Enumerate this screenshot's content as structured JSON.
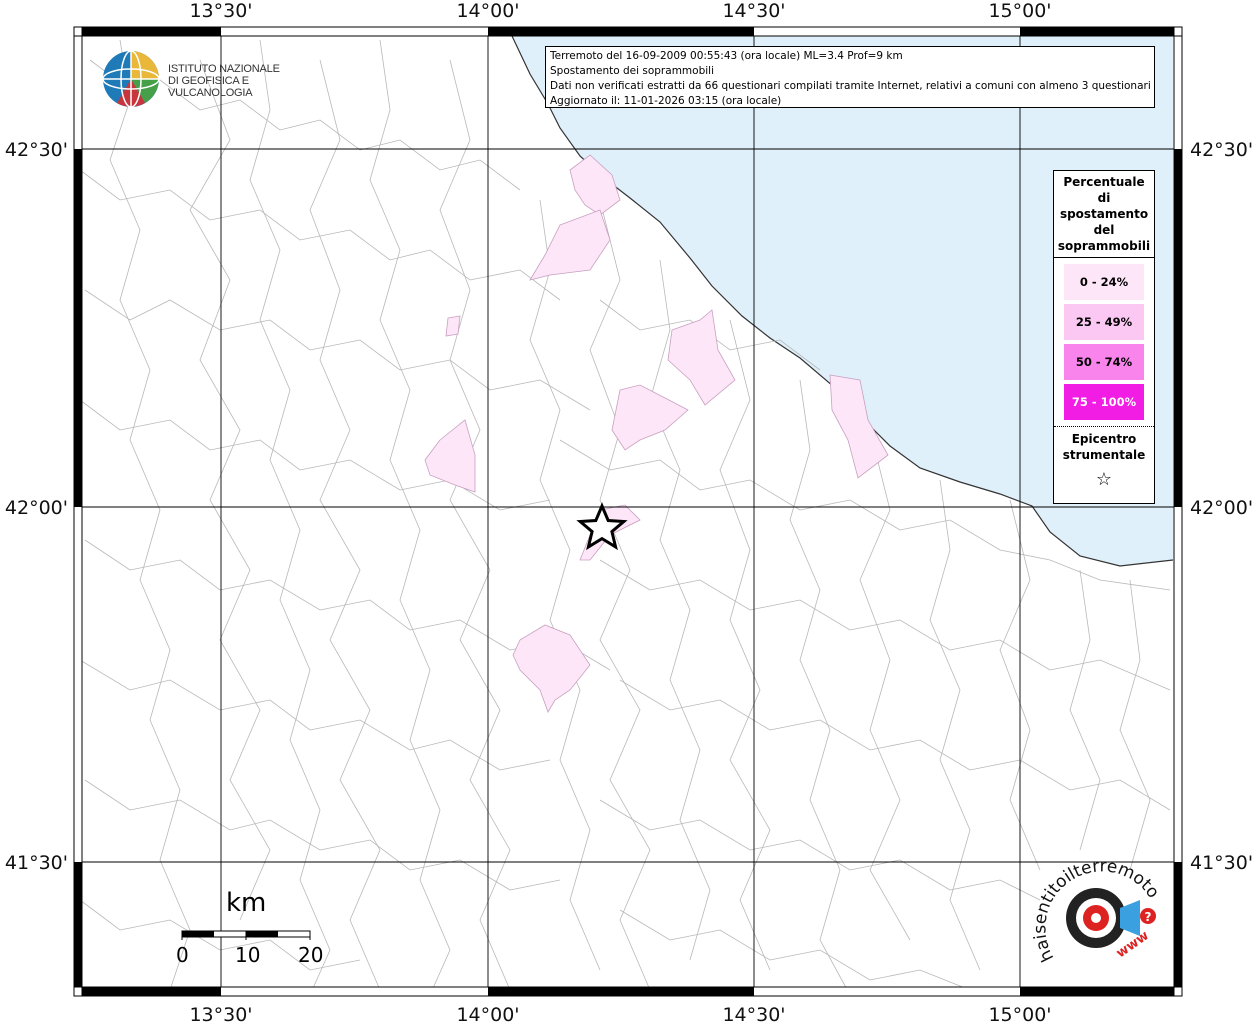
{
  "title_box": {
    "line1": "Terremoto del 16-09-2009 00:55:43 (ora locale) ML=3.4 Prof=9 km",
    "line2": "Spostamento dei soprammobili",
    "line3": "Dati non verificati estratti da 66 questionari compilati tramite Internet, relativi a comuni con almeno 3 questionari.",
    "line4": "Aggiornato il: 11-01-2026 03:15 (ora locale)"
  },
  "logo": {
    "line1": "ISTITUTO NAZIONALE",
    "line2": "DI GEOFISICA E VULCANOLOGIA"
  },
  "lon_labels": [
    "13°30'",
    "14°00'",
    "14°30'",
    "15°00'"
  ],
  "lat_labels": [
    "42°30'",
    "42°00'",
    "41°30'"
  ],
  "legend": {
    "title_lines": [
      "Percentuale",
      "di",
      "spostamento",
      "del",
      "soprammobili"
    ],
    "classes": [
      {
        "label": "0 - 24%",
        "color": "#fde6f8"
      },
      {
        "label": "25 - 49%",
        "color": "#fbc8f3"
      },
      {
        "label": "50 - 74%",
        "color": "#f884ec"
      },
      {
        "label": "75 - 100%",
        "color": "#f21de4"
      }
    ],
    "epicenter_lines": [
      "Epicentro",
      "strumentale"
    ],
    "epicenter_symbol": "☆"
  },
  "scale_bar": {
    "unit": "km",
    "ticks": [
      "0",
      "10",
      "20"
    ]
  },
  "badge": {
    "text_main": "haisentitoilterremoto.it",
    "text_www": "www",
    "question": "?"
  },
  "colors": {
    "sea": "#dff0fb",
    "border": "#000000",
    "municipality_lines": "#b0b0b0",
    "grid": "#000000"
  }
}
